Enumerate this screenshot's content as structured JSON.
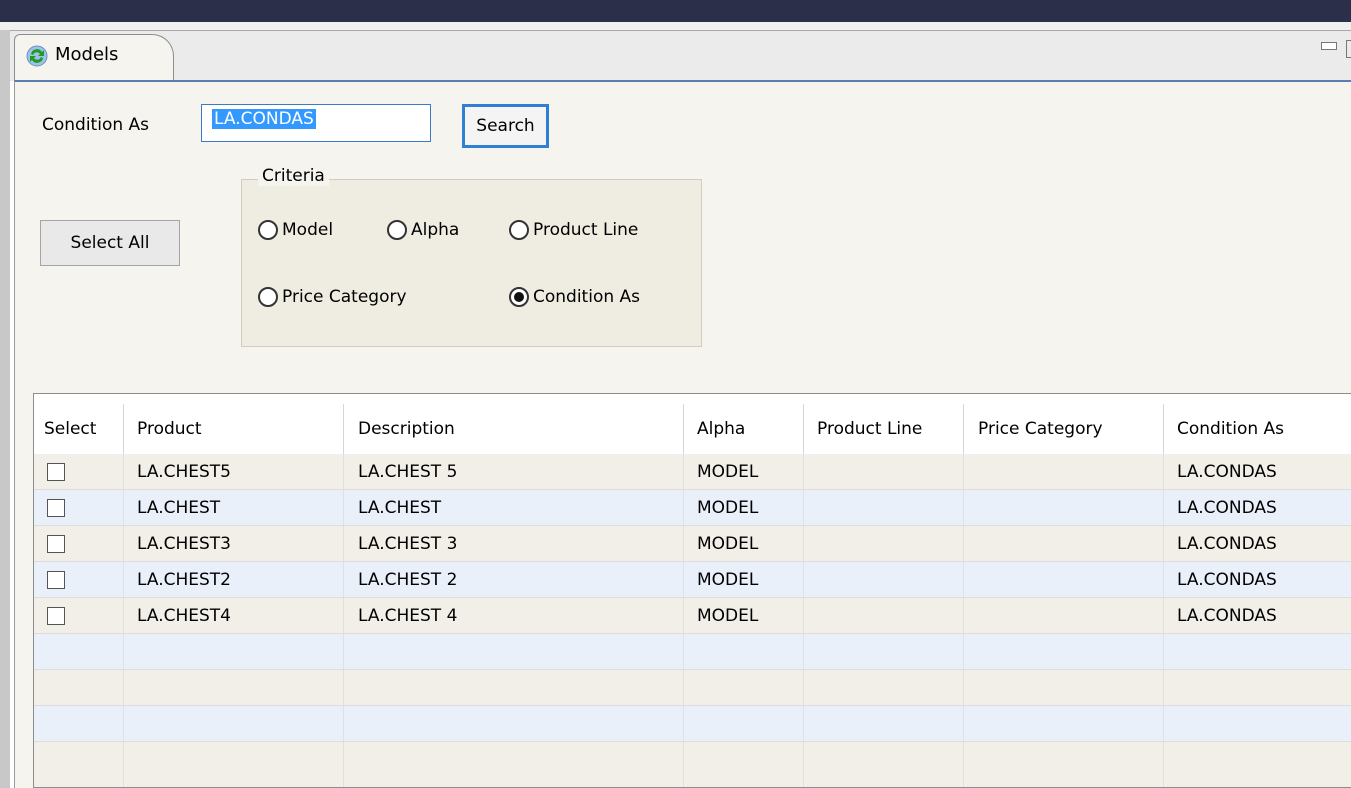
{
  "tab": {
    "label": "Models",
    "icon": "refresh-icon"
  },
  "form": {
    "condition_label": "Condition As",
    "condition_value": "LA.CONDAS",
    "search_label": "Search",
    "select_all_label": "Select All"
  },
  "criteria": {
    "legend": "Criteria",
    "options": [
      {
        "label": "Model",
        "selected": false
      },
      {
        "label": "Alpha",
        "selected": false
      },
      {
        "label": "Product Line",
        "selected": false
      },
      {
        "label": "Price Category",
        "selected": false
      },
      {
        "label": "Condition As",
        "selected": true
      }
    ]
  },
  "table": {
    "headers": [
      "Select",
      "Product",
      "Description",
      "Alpha",
      "Product Line",
      "Price Category",
      "Condition As"
    ],
    "rows": [
      {
        "checked": false,
        "product": "LA.CHEST5",
        "description": "LA.CHEST 5",
        "alpha": "MODEL",
        "product_line": "",
        "price_category": "",
        "condition_as": "LA.CONDAS"
      },
      {
        "checked": false,
        "product": "LA.CHEST",
        "description": "LA.CHEST",
        "alpha": "MODEL",
        "product_line": "",
        "price_category": "",
        "condition_as": "LA.CONDAS"
      },
      {
        "checked": false,
        "product": "LA.CHEST3",
        "description": "LA.CHEST 3",
        "alpha": "MODEL",
        "product_line": "",
        "price_category": "",
        "condition_as": "LA.CONDAS"
      },
      {
        "checked": false,
        "product": "LA.CHEST2",
        "description": "LA.CHEST 2",
        "alpha": "MODEL",
        "product_line": "",
        "price_category": "",
        "condition_as": "LA.CONDAS"
      },
      {
        "checked": false,
        "product": "LA.CHEST4",
        "description": "LA.CHEST 4",
        "alpha": "MODEL",
        "product_line": "",
        "price_category": "",
        "condition_as": "LA.CONDAS"
      }
    ]
  },
  "colors": {
    "accent": "#2f7fd3",
    "selection": "#3399ff",
    "titlebar": "#2b2f4a"
  }
}
